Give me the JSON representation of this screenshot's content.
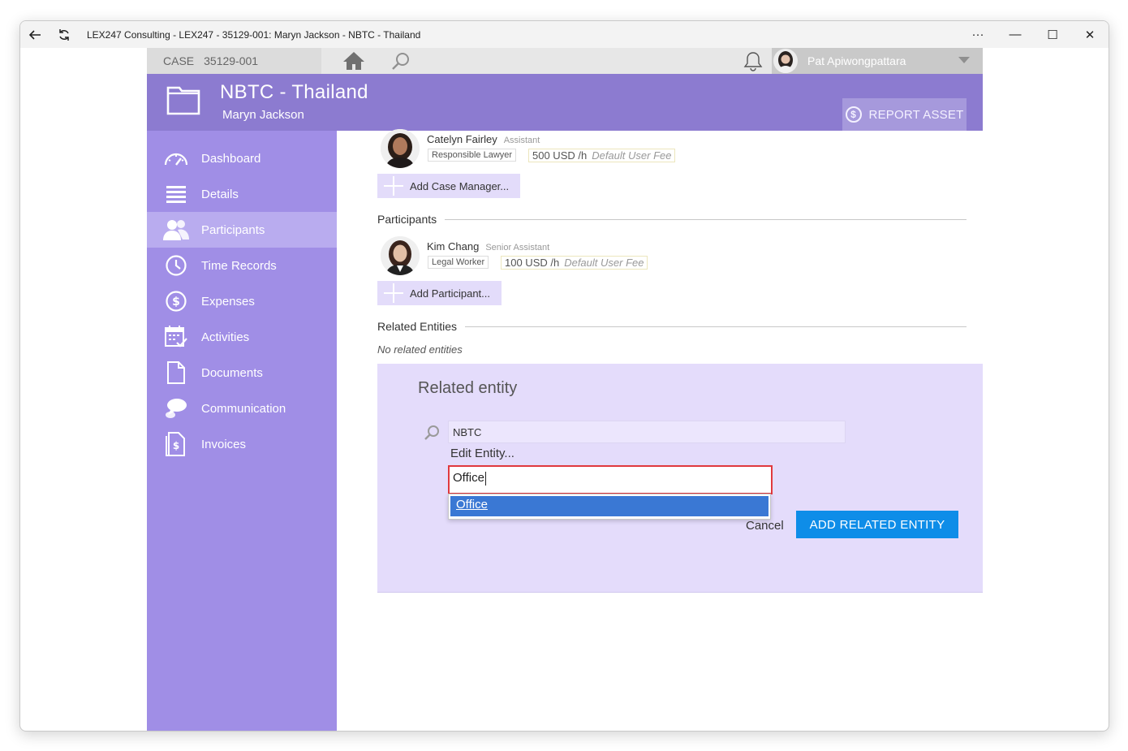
{
  "window": {
    "title": "LEX247 Consulting - LEX247 - 35129-001: Maryn Jackson - NBTC - Thailand",
    "controls": {
      "more": "···",
      "minimize": "—",
      "maximize": "☐",
      "close": "✕"
    }
  },
  "topbar": {
    "case_label": "CASE",
    "case_number": "35129-001",
    "user_name": "Pat Apiwongpattara"
  },
  "header": {
    "title": "NBTC - Thailand",
    "subtitle": "Maryn Jackson",
    "report_button": "REPORT ASSET",
    "report_icon": "$"
  },
  "sidebar": {
    "items": [
      {
        "label": "Dashboard",
        "icon": "gauge-icon"
      },
      {
        "label": "Details",
        "icon": "list-icon"
      },
      {
        "label": "Participants",
        "icon": "people-icon",
        "active": true
      },
      {
        "label": "Time Records",
        "icon": "clock-icon"
      },
      {
        "label": "Expenses",
        "icon": "dollar-circle-icon"
      },
      {
        "label": "Activities",
        "icon": "calendar-check-icon"
      },
      {
        "label": "Documents",
        "icon": "document-icon"
      },
      {
        "label": "Communication",
        "icon": "chat-icon"
      },
      {
        "label": "Invoices",
        "icon": "invoice-icon"
      }
    ]
  },
  "case_managers": {
    "person": {
      "name": "Catelyn Fairley",
      "role": "Assistant",
      "tag": "Responsible Lawyer",
      "fee": "500 USD /h",
      "fee_note": "Default User Fee"
    },
    "add_button": "Add Case Manager..."
  },
  "participants": {
    "title": "Participants",
    "person": {
      "name": "Kim Chang",
      "role": "Senior Assistant",
      "tag": "Legal Worker",
      "fee": "100 USD /h",
      "fee_note": "Default User Fee"
    },
    "add_button": "Add Participant..."
  },
  "related_entities": {
    "title": "Related Entities",
    "empty_text": "No related entities"
  },
  "related_entity_form": {
    "title": "Related entity",
    "search_value": "NBTC",
    "edit_entity": "Edit Entity...",
    "role_input_value": "Office",
    "suggestion": "Office",
    "cancel": "Cancel",
    "submit": "ADD RELATED ENTITY"
  }
}
